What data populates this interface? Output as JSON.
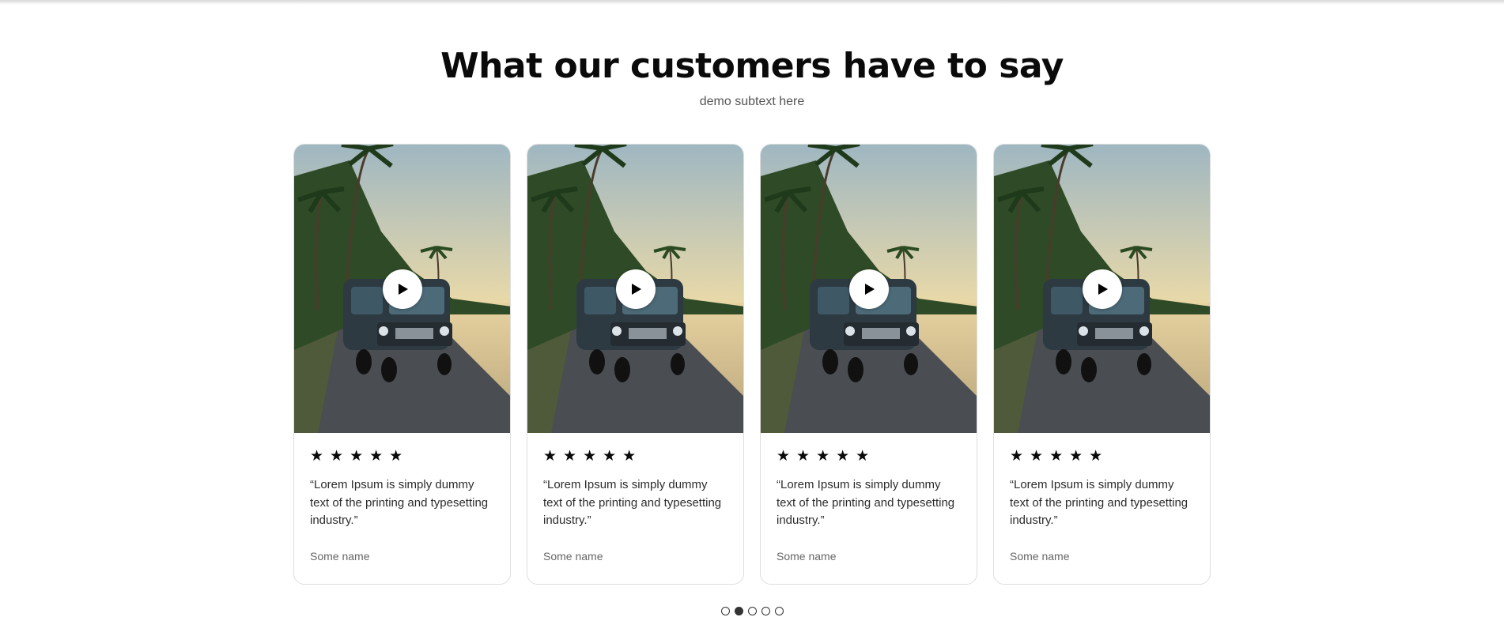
{
  "section": {
    "title": "What our customers have to say",
    "subtitle": "demo subtext here"
  },
  "testimonials": [
    {
      "rating": 5,
      "stars": "★★★★★",
      "quote": "“Lorem Ipsum is simply dummy text of the printing and typesetting industry.”",
      "author": "Some name",
      "media_icon": "play-icon"
    },
    {
      "rating": 5,
      "stars": "★★★★★",
      "quote": "“Lorem Ipsum is simply dummy text of the printing and typesetting industry.”",
      "author": "Some name",
      "media_icon": "play-icon"
    },
    {
      "rating": 5,
      "stars": "★★★★★",
      "quote": "“Lorem Ipsum is simply dummy text of the printing and typesetting industry.”",
      "author": "Some name",
      "media_icon": "play-icon"
    },
    {
      "rating": 5,
      "stars": "★★★★★",
      "quote": "“Lorem Ipsum is simply dummy text of the printing and typesetting industry.”",
      "author": "Some name",
      "media_icon": "play-icon"
    }
  ],
  "pagination": {
    "count": 5,
    "active_index": 1
  },
  "colors": {
    "heading": "#0a0a0a",
    "card_border": "#dedede",
    "dot_active": "#333333"
  }
}
